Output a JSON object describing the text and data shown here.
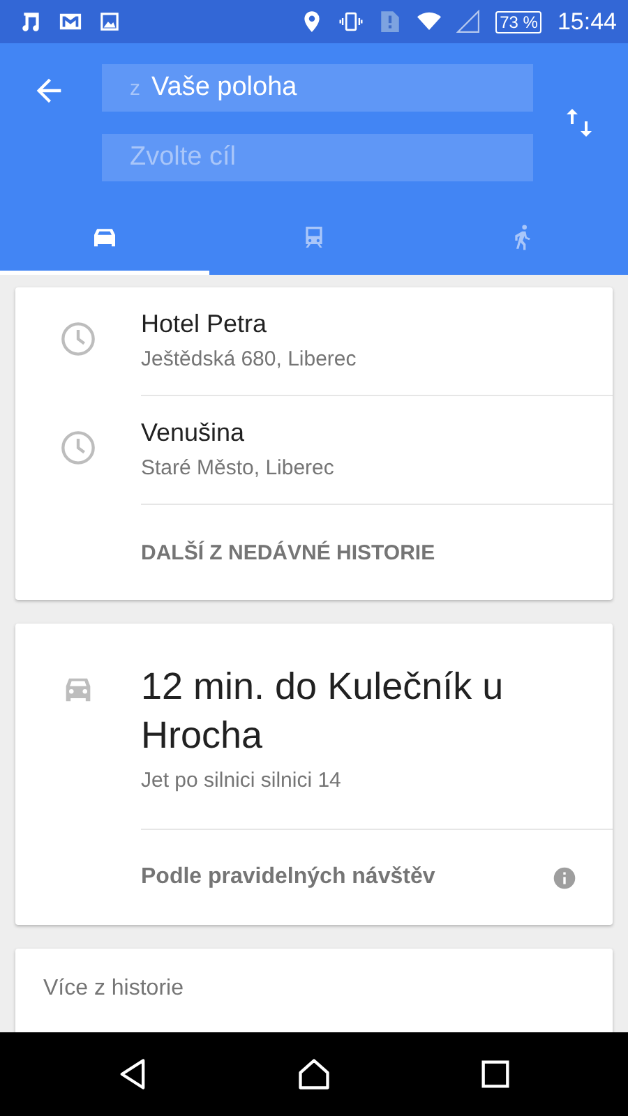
{
  "status_bar": {
    "battery": "73 %",
    "time": "15:44"
  },
  "header": {
    "origin": {
      "prefix": "z",
      "value": "Vaše poloha"
    },
    "destination": {
      "placeholder": "Zvolte cíl"
    }
  },
  "tabs": [
    {
      "kind": "car",
      "selected": true
    },
    {
      "kind": "transit",
      "selected": false
    },
    {
      "kind": "walk",
      "selected": false
    }
  ],
  "recent": {
    "items": [
      {
        "title": "Hotel Petra",
        "subtitle": "Ještědská 680, Liberec"
      },
      {
        "title": "Venušina",
        "subtitle": "Staré Město, Liberec"
      }
    ],
    "more": "DALŠÍ Z NEDÁVNÉ HISTORIE"
  },
  "suggestion": {
    "title": "12 min. do Kulečník u Hrocha",
    "subtitle": "Jet po silnici silnici 14",
    "reason": "Podle pravidelných návštěv"
  },
  "history": {
    "label": "Více z historie"
  }
}
